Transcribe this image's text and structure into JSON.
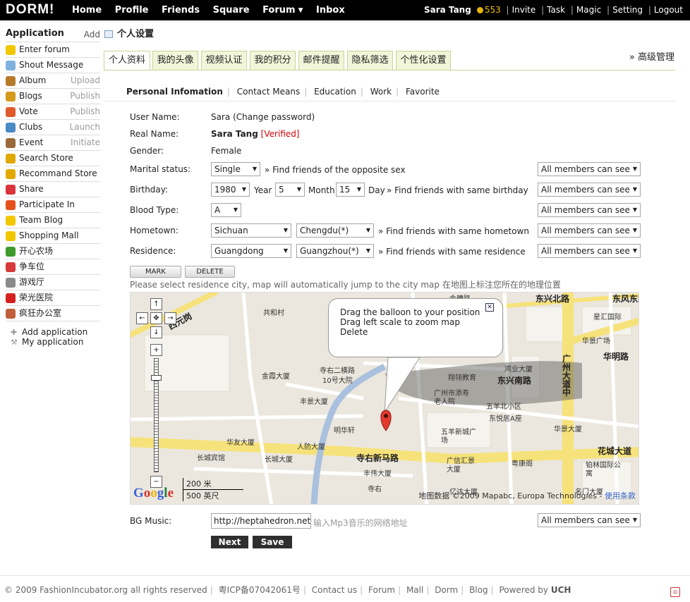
{
  "topbar": {
    "logo": "DORM!",
    "nav": [
      "Home",
      "Profile",
      "Friends",
      "Square",
      "Forum",
      "Inbox"
    ],
    "user": "Sara Tang",
    "points": "553",
    "links": [
      "Invite",
      "Task",
      "Magic",
      "Setting",
      "Logout"
    ]
  },
  "sidebar": {
    "heading": "Application",
    "add": "Add",
    "items": [
      {
        "label": "Enter forum",
        "action": "",
        "icon": "bulb-icon",
        "color": "#f3c700"
      },
      {
        "label": "Shout Message",
        "action": "",
        "icon": "chat-icon",
        "color": "#7fb2de"
      },
      {
        "label": "Album",
        "action": "Upload",
        "icon": "album-icon",
        "color": "#b77a2a"
      },
      {
        "label": "Blogs",
        "action": "Publish",
        "icon": "blog-icon",
        "color": "#d49a1e"
      },
      {
        "label": "Vote",
        "action": "Publish",
        "icon": "vote-icon",
        "color": "#e05b2a"
      },
      {
        "label": "Clubs",
        "action": "Launch",
        "icon": "clubs-icon",
        "color": "#4a8ac4"
      },
      {
        "label": "Event",
        "action": "Initiate",
        "icon": "event-icon",
        "color": "#9a6a3a"
      },
      {
        "label": "Search Store",
        "action": "",
        "icon": "search-store-icon",
        "color": "#e1a800"
      },
      {
        "label": "Recommand Store",
        "action": "",
        "icon": "recommend-store-icon",
        "color": "#e1a800"
      },
      {
        "label": "Share",
        "action": "",
        "icon": "heart-icon",
        "color": "#d8343a"
      },
      {
        "label": "Participate In",
        "action": "",
        "icon": "fire-icon",
        "color": "#e6501c"
      },
      {
        "label": "Team Blog",
        "action": "",
        "icon": "bulb-icon",
        "color": "#f3c700"
      },
      {
        "label": "Shopping Mall",
        "action": "",
        "icon": "bulb-icon",
        "color": "#f3c700"
      },
      {
        "label": "开心农场",
        "action": "",
        "icon": "sprout-icon",
        "color": "#3e9b2b"
      },
      {
        "label": "争车位",
        "action": "",
        "icon": "parking-icon",
        "color": "#d63a3a"
      },
      {
        "label": "游戏厅",
        "action": "",
        "icon": "game-icon",
        "color": "#8a8a8a"
      },
      {
        "label": "荣光医院",
        "action": "",
        "icon": "red-cross-icon",
        "color": "#d62020"
      },
      {
        "label": "疯狂办公室",
        "action": "",
        "icon": "office-icon",
        "color": "#c0603a"
      }
    ],
    "add_application": "Add application",
    "my_application": "My application"
  },
  "page": {
    "title": "个人设置",
    "advanced": "» 高级管理",
    "tabs": [
      "个人资料",
      "我的头像",
      "视频认证",
      "我的积分",
      "邮件提醒",
      "隐私筛选",
      "个性化设置"
    ],
    "subtabs": [
      "Personal Infomation",
      "Contact Means",
      "Education",
      "Work",
      "Favorite"
    ]
  },
  "form": {
    "username_label": "User Name:",
    "username_value": "Sara (Change password)",
    "realname_label": "Real Name:",
    "realname_value": "Sara Tang",
    "verified": "[Verified]",
    "gender_label": "Gender:",
    "gender_value": "Female",
    "marital_label": "Marital status:",
    "marital_value": "Single",
    "marital_note": "» Find friends of the opposite sex",
    "birthday_label": "Birthday:",
    "birth_year": "1980",
    "year_word": "Year",
    "birth_month": "5",
    "month_word": "Month",
    "birth_day": "15",
    "day_word": "Day",
    "birthday_note": "» Find friends with same birthday",
    "blood_label": "Blood Type:",
    "blood_value": "A",
    "hometown_label": "Hometown:",
    "hometown_province": "Sichuan",
    "hometown_city": "Chengdu(*)",
    "hometown_note": "» Find friends with same hometown",
    "residence_label": "Residence:",
    "residence_province": "Guangdong",
    "residence_city": "Guangzhou(*)",
    "residence_note": "» Find friends with same residence",
    "privacy": "All members can see",
    "mark_button": "MARK",
    "delete_button": "DELETE",
    "map_hint": "Please select residence city, map will automatically jump to the city map 在地图上标注您所在的地理位置",
    "bg_music_label": "BG Music:",
    "bg_music_value": "http://heptahedron.net/",
    "bg_music_placeholder": "输入Mp3音乐的网络地址",
    "next_button": "Next",
    "save_button": "Save"
  },
  "map": {
    "balloon_lines": [
      "Drag the balloon to your position",
      "Drag left scale to zoom map",
      "Delete"
    ],
    "labels": [
      "东风东路",
      "金穗路",
      "星汇国际",
      "共和村",
      "西元岗",
      "东兴北路",
      "寺右二横路",
      "10号大院",
      "金霞大厦",
      "华景广场",
      "华明路",
      "鸿业大厦",
      "东兴南路",
      "翔翎教育",
      "广州大道中",
      "丰景大厦",
      "广州市添寿老人院",
      "五羊北小区",
      "东悦居A座",
      "明华轩",
      "五羊新城广场",
      "华景大厦",
      "华友大厦",
      "人防大厦",
      "寺右新马路",
      "花城大道",
      "长城宾馆",
      "长城大厦",
      "广信汇景大厦",
      "粤康阁",
      "铂林国际公寓",
      "丰伟大厦",
      "名门大厦",
      "寺右",
      "亿达大厦"
    ],
    "scale_m": "200 米",
    "scale_ft": "500 英尺",
    "copyright": "地图数据 ©2009 Mapabc, Europa Technologies -",
    "terms": "使用条款",
    "google": "Google"
  },
  "footer": {
    "copyright": "© 2009 FashionIncubator.org all rights reserved",
    "icp": "粤ICP备07042061号",
    "links": [
      "Contact us",
      "Forum",
      "Mall",
      "Dorm",
      "Blog"
    ],
    "powered": "Powered by",
    "powered_brand": "UCH"
  }
}
